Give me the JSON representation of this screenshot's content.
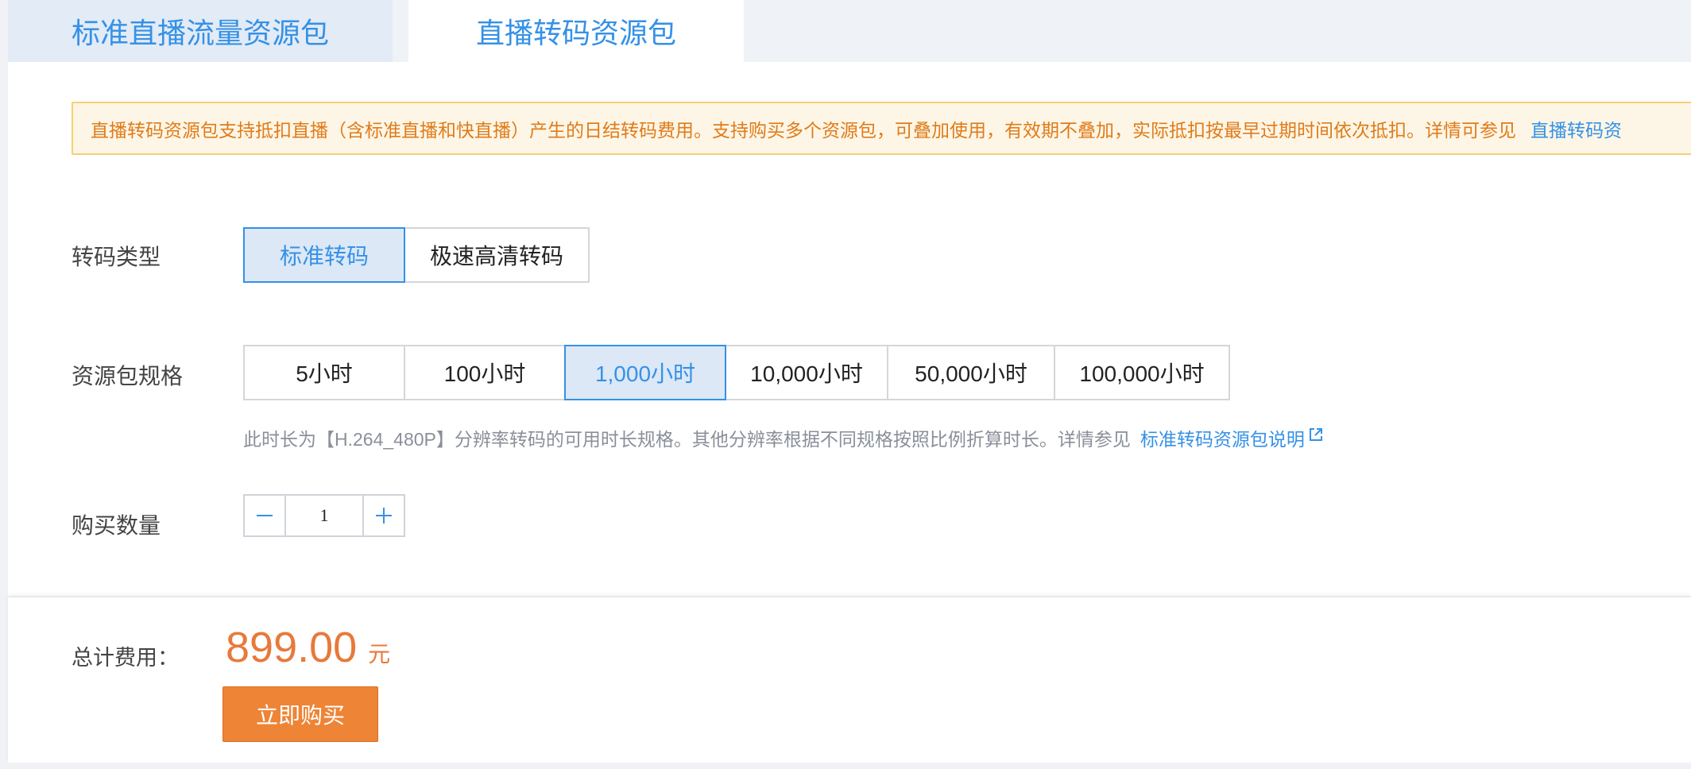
{
  "tabs": [
    {
      "label": "标准直播流量资源包"
    },
    {
      "label": "直播转码资源包"
    }
  ],
  "notice": {
    "text": "直播转码资源包支持抵扣直播（含标准直播和快直播）产生的日结转码费用。支持购买多个资源包，可叠加使用，有效期不叠加，实际抵扣按最早过期时间依次抵扣。详情可参见",
    "link": "直播转码资"
  },
  "transcode_type": {
    "label": "转码类型",
    "options": [
      "标准转码",
      "极速高清转码"
    ],
    "selected": "标准转码"
  },
  "package_spec": {
    "label": "资源包规格",
    "options": [
      "5小时",
      "100小时",
      "1,000小时",
      "10,000小时",
      "50,000小时",
      "100,000小时"
    ],
    "selected": "1,000小时",
    "hint": "此时长为【H.264_480P】分辨率转码的可用时长规格。其他分辨率根据不同规格按照比例折算时长。详情参见",
    "hint_link": "标准转码资源包说明"
  },
  "quantity": {
    "label": "购买数量",
    "value": "1"
  },
  "footer": {
    "total_label": "总计费用：",
    "price": "899.00",
    "unit": "元",
    "buy_label": "立即购买"
  },
  "colors": {
    "accent_blue": "#3591e6",
    "price_orange": "#e8793a",
    "buy_button": "#ee8436",
    "notice_bg": "#fdf6e6",
    "notice_border": "#f8cf72"
  }
}
